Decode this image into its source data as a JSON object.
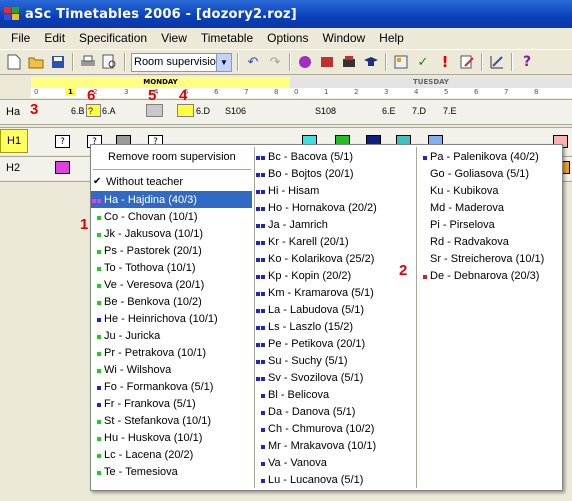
{
  "window": {
    "title": "aSc Timetables 2006  - [dozory2.roz]"
  },
  "menu_items": [
    "File",
    "Edit",
    "Specification",
    "View",
    "Timetable",
    "Options",
    "Window",
    "Help"
  ],
  "toolbar": {
    "combo_value": "Room supervision"
  },
  "days": [
    "MONDAY",
    "TUESDAY"
  ],
  "hours": [
    "0",
    "1",
    "2",
    "3",
    "4",
    "5",
    "6",
    "7",
    "8",
    "0",
    "1",
    "2",
    "3",
    "4",
    "5",
    "6",
    "7",
    "8"
  ],
  "rows": {
    "ha": {
      "label": "Ha",
      "cells": [
        "6.B",
        "?",
        "6.A",
        "6.D",
        "S106",
        "S108",
        "6.E",
        "7.D",
        "7.E"
      ]
    },
    "h1": {
      "label": "H1"
    },
    "h2": {
      "label": "H2"
    }
  },
  "markers": [
    "1",
    "2",
    "3",
    "4",
    "5",
    "6"
  ],
  "popup": {
    "remove": "Remove room supervision",
    "without": "Without teacher",
    "check": "✔",
    "col1": [
      {
        "t": "Ha - Hajdina (40/3)",
        "c": [
          "#e040e0",
          "#e040e0"
        ]
      },
      {
        "t": "Co - Chovan (10/1)",
        "c": [
          "#22cc22"
        ]
      },
      {
        "t": "Jk - Jakusova (10/1)",
        "c": [
          "#22cc22"
        ]
      },
      {
        "t": "Ps - Pastorek (20/1)",
        "c": [
          "#22cc22"
        ]
      },
      {
        "t": "To - Tothova (10/1)",
        "c": [
          "#22cc22"
        ]
      },
      {
        "t": "Ve - Veresova (20/1)",
        "c": [
          "#22cc22"
        ]
      },
      {
        "t": "Be - Benkova (10/2)",
        "c": [
          "#22cc22"
        ]
      },
      {
        "t": "He - Heinrichova (10/1)",
        "c": [
          "#2222cc"
        ]
      },
      {
        "t": "Ju - Juricka",
        "c": [
          "#22cc22"
        ]
      },
      {
        "t": "Pr - Petrakova (10/1)",
        "c": [
          "#22cc22"
        ]
      },
      {
        "t": "Wi - Wilshova",
        "c": [
          "#22cc22"
        ]
      },
      {
        "t": "Fo - Formankova (5/1)",
        "c": [
          "#2222cc"
        ]
      },
      {
        "t": "Fr - Frankova (5/1)",
        "c": [
          "#2222cc"
        ]
      },
      {
        "t": "St - Stefankova (10/1)",
        "c": [
          "#22cc22"
        ]
      },
      {
        "t": "Hu - Huskova (10/1)",
        "c": [
          "#22cc22"
        ]
      },
      {
        "t": "Lc - Lacena (20/2)",
        "c": [
          "#22cc22"
        ]
      },
      {
        "t": "Te - Temesiova",
        "c": [
          "#22cc22"
        ]
      }
    ],
    "col2": [
      {
        "t": "Bc - Bacova (5/1)",
        "c": [
          "#2222cc",
          "#2222cc"
        ]
      },
      {
        "t": "Bo - Bojtos (20/1)",
        "c": [
          "#2222cc",
          "#2222cc"
        ]
      },
      {
        "t": "Hi - Hisam",
        "c": [
          "#2222cc",
          "#2222cc"
        ]
      },
      {
        "t": "Ho - Hornakova (20/2)",
        "c": [
          "#2222cc",
          "#2222cc"
        ]
      },
      {
        "t": "Ja - Jamrich",
        "c": [
          "#2222cc",
          "#2222cc"
        ]
      },
      {
        "t": "Kr - Karell (20/1)",
        "c": [
          "#2222cc",
          "#2222cc"
        ]
      },
      {
        "t": "Ko - Kolarikova (25/2)",
        "c": [
          "#2222cc",
          "#2222cc"
        ]
      },
      {
        "t": "Kp - Kopin (20/2)",
        "c": [
          "#2222cc",
          "#2222cc"
        ]
      },
      {
        "t": "Km - Kramarova (5/1)",
        "c": [
          "#2222cc",
          "#2222cc"
        ]
      },
      {
        "t": "La - Labudova (5/1)",
        "c": [
          "#2222cc",
          "#2222cc"
        ]
      },
      {
        "t": "Ls - Laszlo (15/2)",
        "c": [
          "#2222cc",
          "#2222cc"
        ]
      },
      {
        "t": "Pe - Petikova (20/1)",
        "c": [
          "#2222cc",
          "#2222cc"
        ]
      },
      {
        "t": "Su - Suchy (5/1)",
        "c": [
          "#2222cc",
          "#2222cc"
        ]
      },
      {
        "t": "Sv - Svozilova (5/1)",
        "c": [
          "#2222cc",
          "#2222cc"
        ]
      },
      {
        "t": "Bl - Belicova",
        "c": [
          "#2222cc"
        ]
      },
      {
        "t": "Da - Danova (5/1)",
        "c": [
          "#2222cc"
        ]
      },
      {
        "t": "Ch - Chmurova (10/2)",
        "c": [
          "#2222cc"
        ]
      },
      {
        "t": "Mr - Mrakavova (10/1)",
        "c": [
          "#2222cc"
        ]
      },
      {
        "t": "Va - Vanova",
        "c": [
          "#2222cc"
        ]
      },
      {
        "t": "Lu - Lucanova (5/1)",
        "c": [
          "#2222cc"
        ]
      }
    ],
    "col3": [
      {
        "t": "Pa - Palenikova (40/2)",
        "c": [
          "#2222cc"
        ]
      },
      {
        "t": "Go - Goliasova (5/1)",
        "c": []
      },
      {
        "t": "Ku - Kubikova",
        "c": []
      },
      {
        "t": "Md - Maderova",
        "c": []
      },
      {
        "t": "Pi - Pirselova",
        "c": []
      },
      {
        "t": "Rd - Radvakova",
        "c": []
      },
      {
        "t": "Sr - Streicherova (10/1)",
        "c": []
      },
      {
        "t": "De - Debnarova (20/3)",
        "c": [
          "#cc2222"
        ]
      }
    ]
  }
}
